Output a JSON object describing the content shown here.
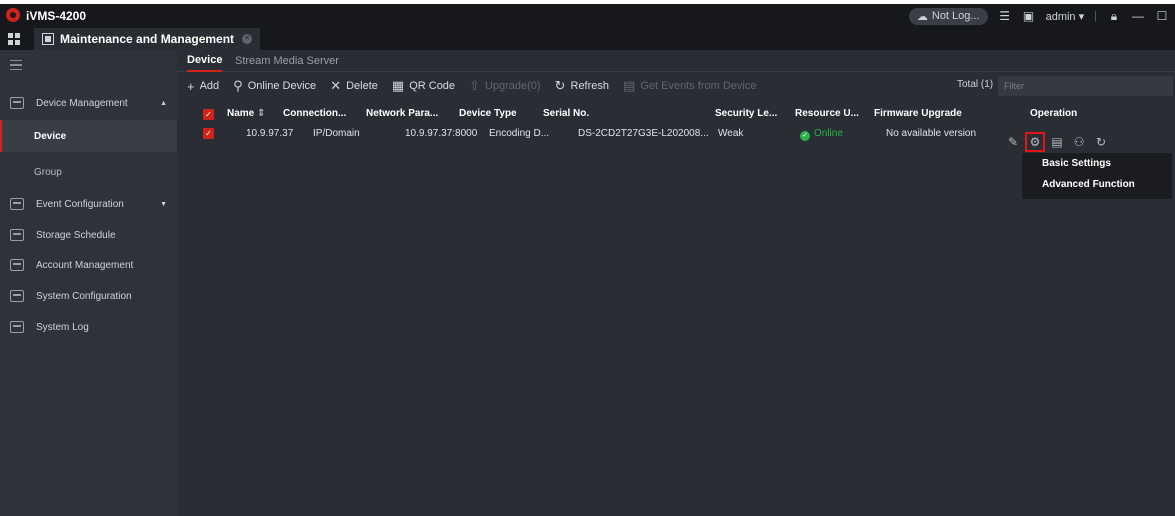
{
  "app": {
    "title": "iVMS-4200",
    "not_logged": "Not Log...",
    "user": "admin",
    "main_tab": "Maintenance and Management"
  },
  "sidebar": {
    "device_management": "Device Management",
    "device": "Device",
    "group": "Group",
    "event_configuration": "Event Configuration",
    "storage_schedule": "Storage Schedule",
    "account_management": "Account Management",
    "system_configuration": "System Configuration",
    "system_log": "System Log"
  },
  "subtabs": {
    "device": "Device",
    "stream": "Stream Media Server"
  },
  "toolbar": {
    "add": "Add",
    "online_device": "Online Device",
    "delete": "Delete",
    "qr_code": "QR Code",
    "upgrade": "Upgrade(0)",
    "refresh": "Refresh",
    "get_events": "Get Events from Device",
    "total": "Total (1)",
    "filter_placeholder": "Filter"
  },
  "table": {
    "headers": {
      "name": "Name",
      "connection": "Connection...",
      "network": "Network Para...",
      "device_type": "Device Type",
      "serial": "Serial No.",
      "security": "Security Le...",
      "resource": "Resource U...",
      "firmware": "Firmware Upgrade",
      "operation": "Operation"
    },
    "row": {
      "name": "10.9.97.37",
      "connection": "IP/Domain",
      "network": "10.9.97.37:8000",
      "device_type": "Encoding D...",
      "serial": "DS-2CD2T27G3E-L202008...",
      "security": "Weak",
      "resource": "Online",
      "firmware": "No available version"
    }
  },
  "dropdown": {
    "basic_settings": "Basic Settings",
    "advanced_function": "Advanced Function"
  },
  "colors": {
    "accent": "#d0231b",
    "online": "#29b34a"
  }
}
